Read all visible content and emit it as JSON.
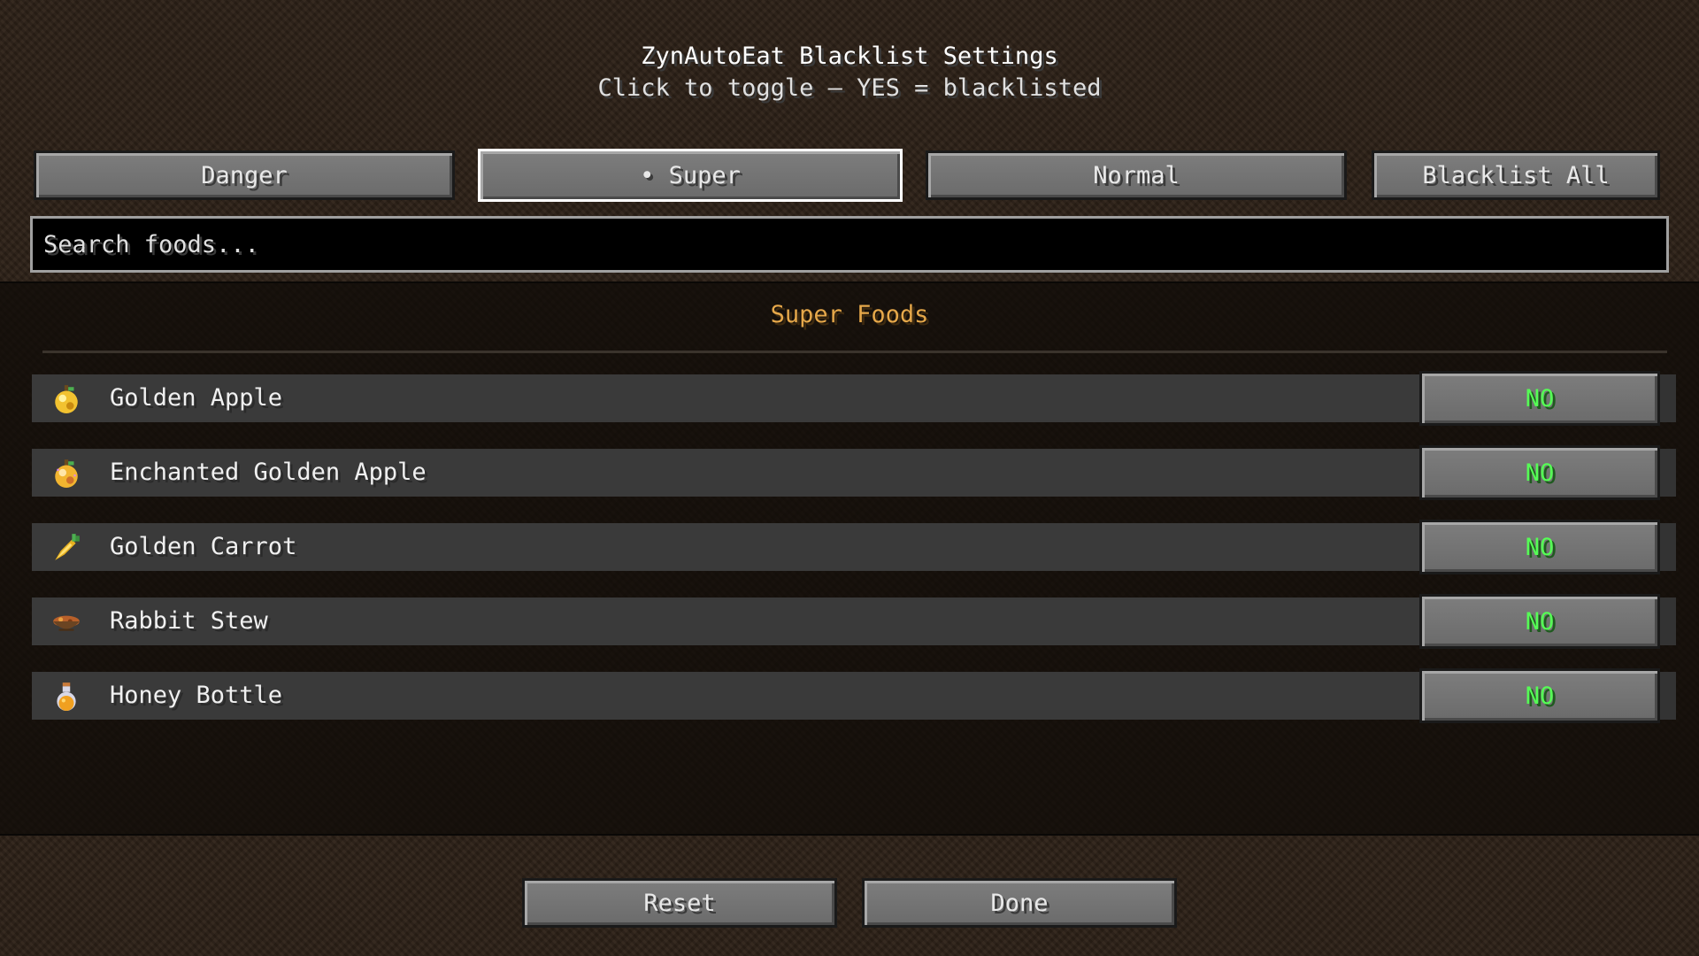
{
  "header": {
    "title": "ZynAutoEat Blacklist Settings",
    "subtitle": "Click to toggle — YES = blacklisted"
  },
  "tabs": [
    {
      "label": "Danger",
      "selected": false
    },
    {
      "label": "• Super",
      "selected": true
    },
    {
      "label": "Normal",
      "selected": false
    },
    {
      "label": "Blacklist All",
      "selected": false
    }
  ],
  "search": {
    "placeholder": "Search foods...",
    "value": ""
  },
  "section": {
    "title": "Super Foods"
  },
  "foods": [
    {
      "name": "Golden Apple",
      "icon": "golden-apple-icon",
      "status": "NO"
    },
    {
      "name": "Enchanted Golden Apple",
      "icon": "enchanted-golden-apple-icon",
      "status": "NO"
    },
    {
      "name": "Golden Carrot",
      "icon": "golden-carrot-icon",
      "status": "NO"
    },
    {
      "name": "Rabbit Stew",
      "icon": "rabbit-stew-icon",
      "status": "NO"
    },
    {
      "name": "Honey Bottle",
      "icon": "honey-bottle-icon",
      "status": "NO"
    }
  ],
  "footer": {
    "reset_label": "Reset",
    "done_label": "Done"
  },
  "colors": {
    "status_no": "#55ff55",
    "section_title": "#e6a84a"
  }
}
